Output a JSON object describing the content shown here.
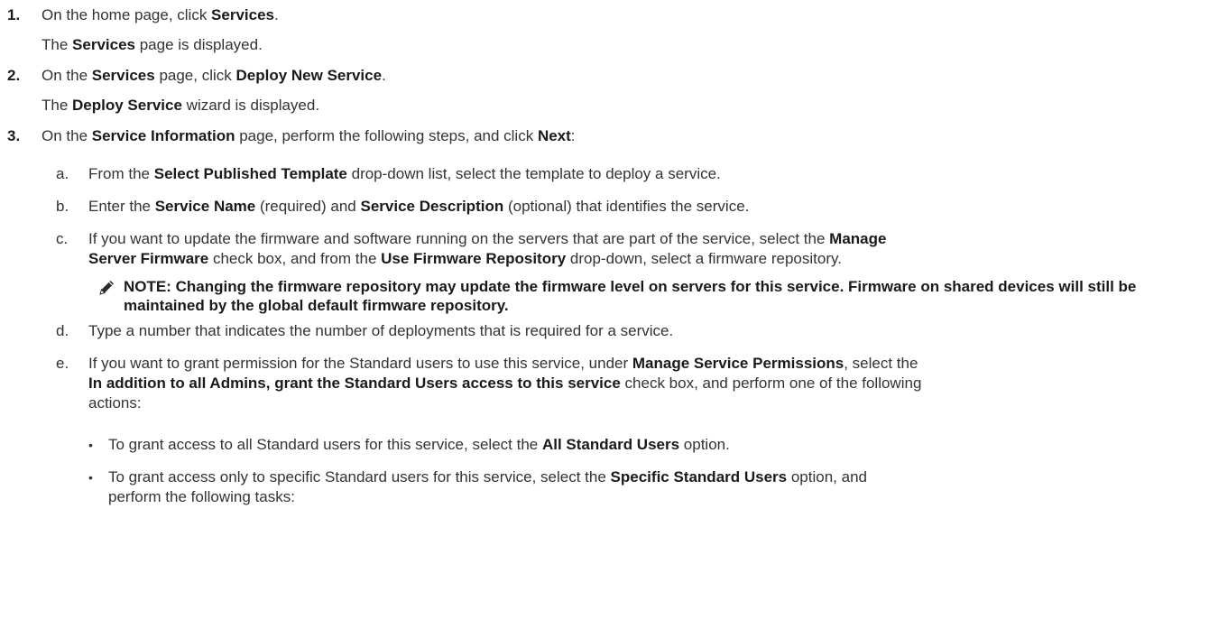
{
  "steps": [
    {
      "number": "1.",
      "text": [
        "On the home page, click ",
        {
          "b": "Services"
        },
        "."
      ],
      "result": [
        "The ",
        {
          "b": "Services"
        },
        " page is displayed."
      ]
    },
    {
      "number": "2.",
      "text": [
        "On the ",
        {
          "b": "Services"
        },
        " page, click ",
        {
          "b": "Deploy New Service"
        },
        "."
      ],
      "result": [
        "The ",
        {
          "b": "Deploy Service"
        },
        " wizard is displayed."
      ]
    },
    {
      "number": "3.",
      "text": [
        "On the ",
        {
          "b": "Service Information"
        },
        " page, perform the following steps, and click ",
        {
          "b": "Next"
        },
        ":"
      ]
    }
  ],
  "substeps": [
    {
      "letter": "a.",
      "lines": [
        [
          "From the ",
          {
            "b": "Select Published Template"
          },
          " drop-down list, select the template to deploy a service."
        ]
      ]
    },
    {
      "letter": "b.",
      "lines": [
        [
          "Enter the ",
          {
            "b": "Service Name"
          },
          " (required) and ",
          {
            "b": "Service Description"
          },
          " (optional) that identifies the service."
        ]
      ]
    },
    {
      "letter": "c.",
      "lines": [
        [
          "If you want to update the firmware and software running on the servers that are part of the service, select the ",
          {
            "b": "Manage"
          }
        ],
        [
          {
            "b": "Server Firmware"
          },
          " check box, and from the ",
          {
            "b": "Use Firmware Repository"
          },
          " drop-down, select a firmware repository."
        ]
      ]
    },
    {
      "letter": "d.",
      "lines": [
        [
          "Type a number that indicates the number of deployments that is required for a service."
        ]
      ]
    },
    {
      "letter": "e.",
      "lines": [
        [
          "If you want to grant permission for the Standard users to use this service, under ",
          {
            "b": "Manage Service Permissions"
          },
          ", select the"
        ],
        [
          {
            "b": "In addition to all Admins, grant the Standard Users access to this service"
          },
          " check box, and perform one of the following"
        ],
        [
          "actions:"
        ]
      ]
    }
  ],
  "note": {
    "icon": "note-pencil-icon",
    "text": "NOTE: Changing the firmware repository may update the firmware level on servers for this service. Firmware on shared devices will still be maintained by the global default firmware repository."
  },
  "bullets": [
    {
      "symbol": "•",
      "lines": [
        [
          "To grant access to all Standard users for this service, select the ",
          {
            "b": "All Standard Users"
          },
          " option."
        ]
      ]
    },
    {
      "symbol": "•",
      "lines": [
        [
          "To grant access only to specific Standard users for this service, select the ",
          {
            "b": "Specific Standard Users"
          },
          " option, and"
        ],
        [
          "perform the following tasks:"
        ]
      ]
    }
  ]
}
